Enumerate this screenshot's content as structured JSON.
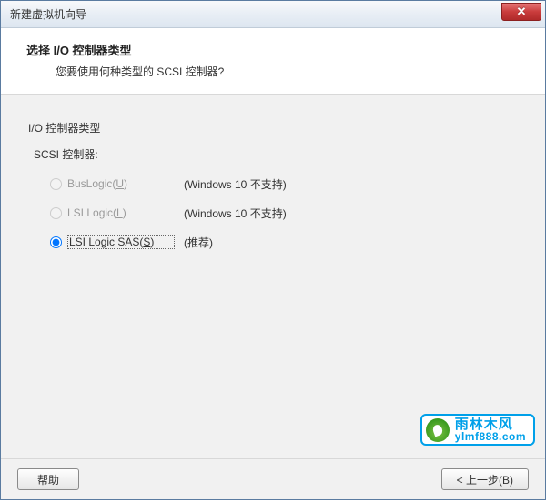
{
  "titlebar": {
    "title": "新建虚拟机向导"
  },
  "header": {
    "title": "选择 I/O 控制器类型",
    "subtitle": "您要使用何种类型的 SCSI 控制器?"
  },
  "content": {
    "group_label": "I/O 控制器类型",
    "sub_label": "SCSI 控制器:",
    "options": [
      {
        "label_pre": "BusLogic(",
        "mnemonic": "U",
        "label_post": ")",
        "note": "(Windows 10 不支持)",
        "enabled": false,
        "selected": false
      },
      {
        "label_pre": "LSI Logic(",
        "mnemonic": "L",
        "label_post": ")",
        "note": "(Windows 10 不支持)",
        "enabled": false,
        "selected": false
      },
      {
        "label_pre": "LSI Logic SAS(",
        "mnemonic": "S",
        "label_post": ")",
        "note": "(推荐)",
        "enabled": true,
        "selected": true
      }
    ]
  },
  "buttons": {
    "help": "帮助",
    "back": "< 上一步(B)"
  },
  "watermark": {
    "cn": "雨林木风",
    "url": "ylmf888.com"
  }
}
